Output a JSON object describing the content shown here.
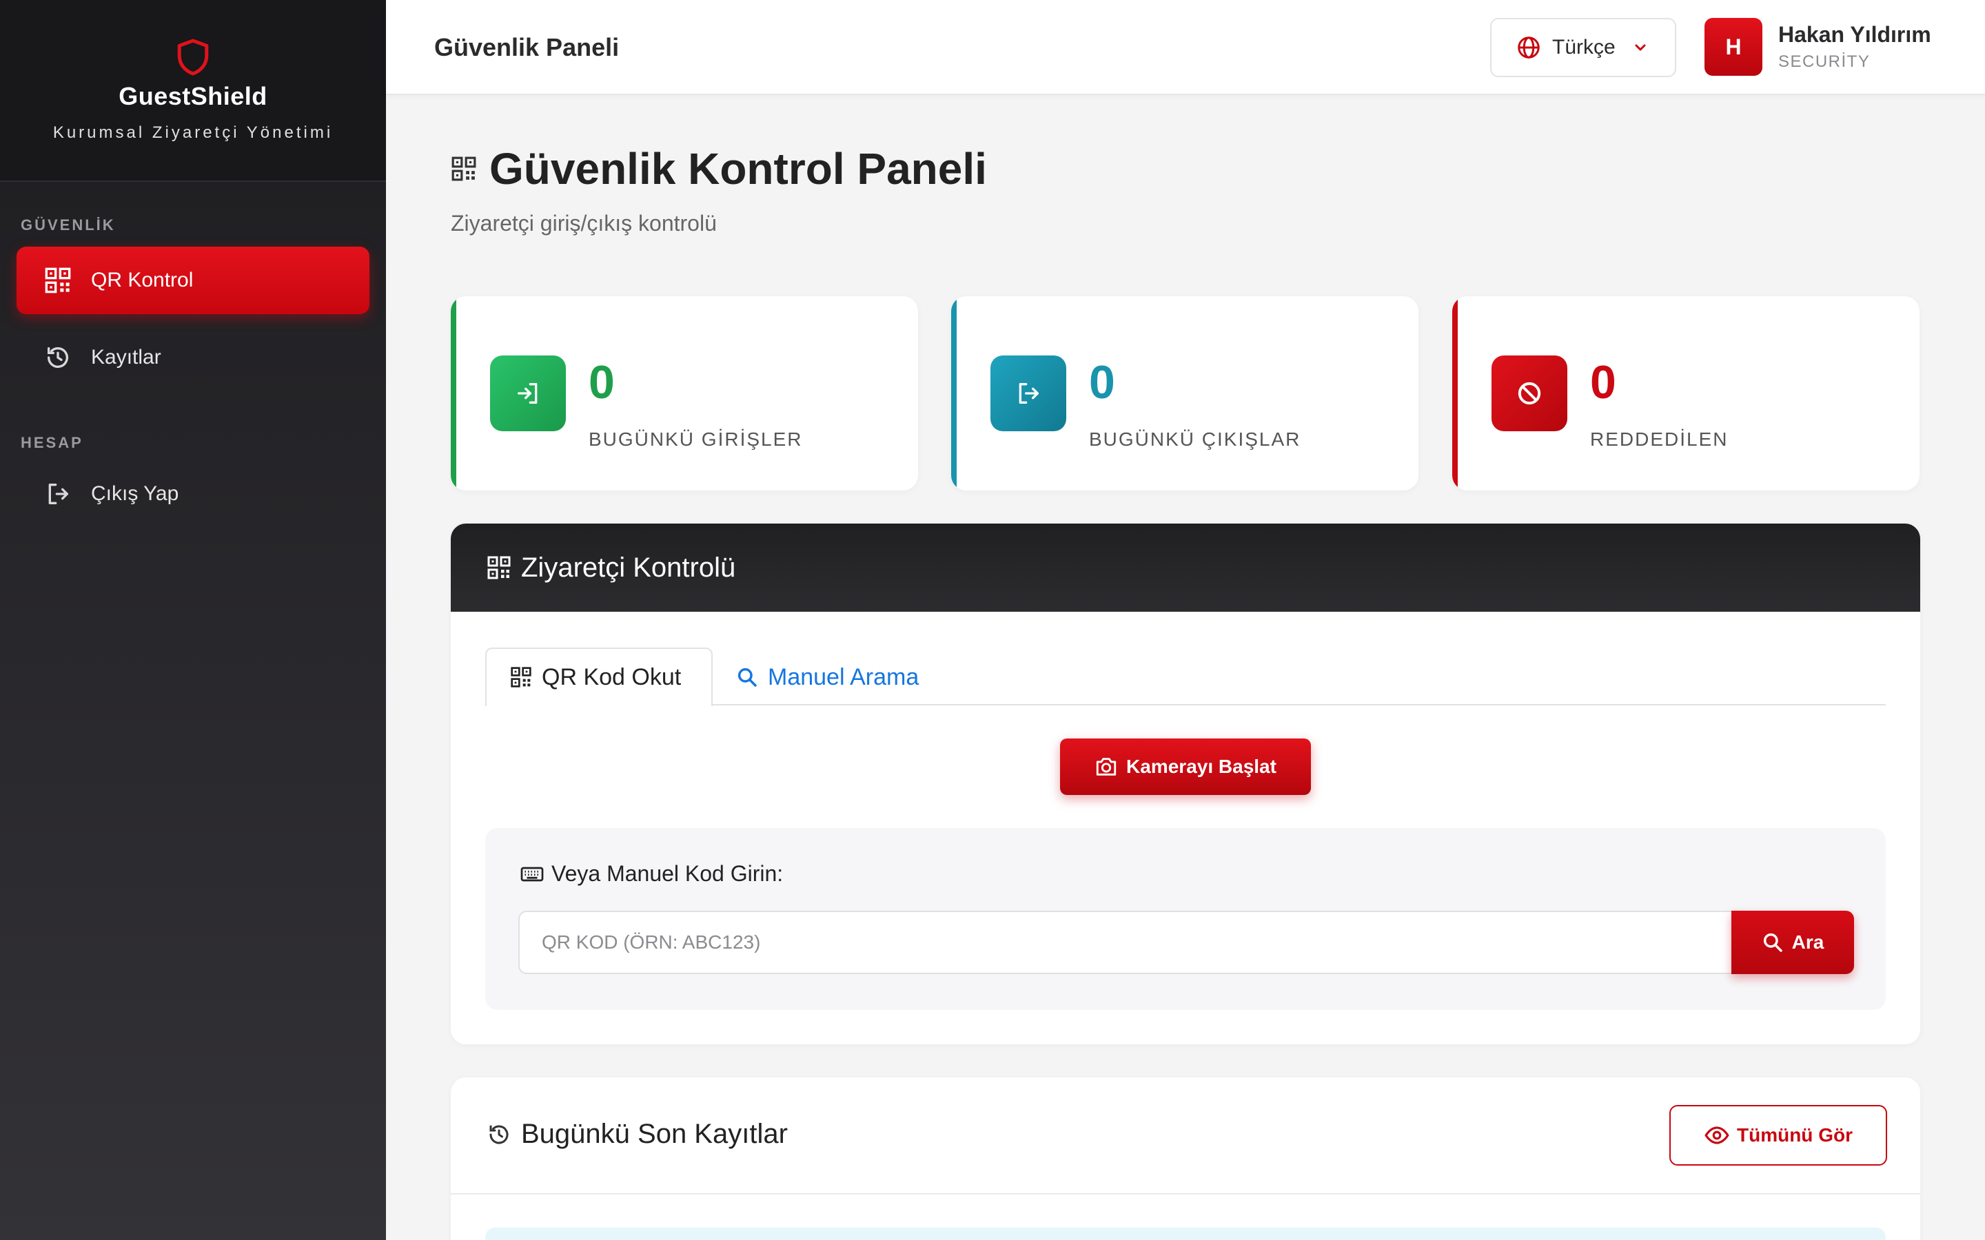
{
  "brand": {
    "name": "GuestShield",
    "subtitle": "Kurumsal Ziyaretçi Yönetimi"
  },
  "sidebar": {
    "sections": [
      {
        "title": "GÜVENLİK",
        "items": [
          {
            "label": "QR Kontrol",
            "icon": "qrcode-icon",
            "active": true
          },
          {
            "label": "Kayıtlar",
            "icon": "history-icon",
            "active": false
          }
        ]
      },
      {
        "title": "HESAP",
        "items": [
          {
            "label": "Çıkış Yap",
            "icon": "logout-icon",
            "active": false
          }
        ]
      }
    ]
  },
  "topbar": {
    "title": "Güvenlik Paneli",
    "language": "Türkçe",
    "user": {
      "initial": "H",
      "name": "Hakan Yıldırım",
      "role": "SECURİTY"
    }
  },
  "page": {
    "title": "Güvenlik Kontrol Paneli",
    "subtitle": "Ziyaretçi giriş/çıkış kontrolü"
  },
  "stats": [
    {
      "value": "0",
      "label": "BUGÜNKÜ GİRİŞLER",
      "icon": "login-icon",
      "color": "#1f9f49"
    },
    {
      "value": "0",
      "label": "BUGÜNKÜ ÇIKIŞLAR",
      "icon": "logout-icon",
      "color": "#1a93ad"
    },
    {
      "value": "0",
      "label": "REDDEDİLEN",
      "icon": "ban-icon",
      "color": "#cc0812"
    }
  ],
  "visitor_panel": {
    "title": "Ziyaretçi Kontrolü",
    "tabs": [
      {
        "label": "QR Kod Okut",
        "active": true
      },
      {
        "label": "Manuel Arama",
        "active": false
      }
    ],
    "camera_button": "Kamerayı Başlat",
    "manual_label": "Veya Manuel Kod Girin:",
    "code_input": {
      "value": "",
      "placeholder": "QR KOD (ÖRN: ABC123)"
    },
    "search_button": "Ara"
  },
  "records_panel": {
    "title": "Bugünkü Son Kayıtlar",
    "view_all_button": "Tümünü Gör"
  },
  "colors": {
    "accent": "#cc0812",
    "sidebar_bg": "#1d1c1f",
    "link": "#1576e0"
  }
}
